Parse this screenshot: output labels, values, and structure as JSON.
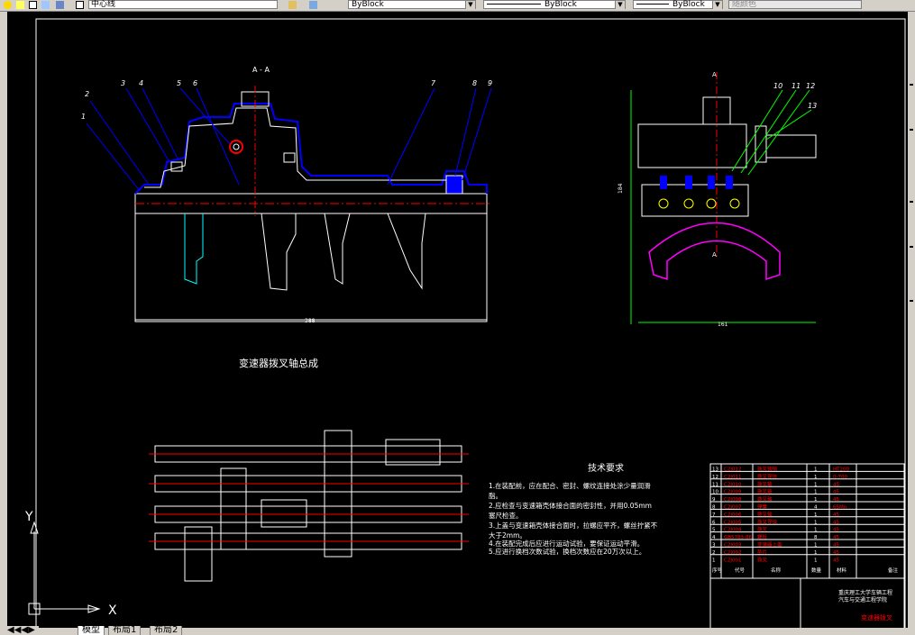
{
  "toolbar": {
    "layer_name": "中心线",
    "linetype_1": "ByBlock",
    "linetype_2": "ByBlock",
    "lineweight": "ByBlock",
    "plotstyle": "随颜色"
  },
  "drawing": {
    "section_label": "A - A",
    "main_title": "变速器拨叉轴总成",
    "dim_width": "388",
    "dim_side_width": "161",
    "dim_side_height": "184",
    "balloon_left": [
      "1",
      "2",
      "3",
      "4",
      "5",
      "6",
      "7",
      "8",
      "9"
    ],
    "balloon_right": [
      "10",
      "11",
      "12",
      "13"
    ],
    "section_mark": "A",
    "tech_title": "技术要求",
    "tech_lines": [
      "1.在装配前，应在配合、密封、螺纹连接处涂少量润滑",
      "脂。",
      "2.应检查与变速箱壳体接合面的密封性，并用0.05mm",
      "塞尺检查。",
      "3.上盖与变速箱壳体接合面时，拉螺应平齐，螺丝拧紧不",
      "大于2mm。",
      "4.在装配完成后应进行运动试验，要保证运动平滑。",
      "5.应进行换档次数试验，换档次数应在20万次以上。"
    ],
    "bom": [
      {
        "no": "13",
        "code": "C2J012",
        "name": "拨叉锁销",
        "qty": "1",
        "mat": "HT200"
      },
      {
        "no": "12",
        "code": "C2J011",
        "name": "拨叉导块",
        "qty": "1",
        "mat": "0-700"
      },
      {
        "no": "11",
        "code": "C2J010",
        "name": "拨叉轴",
        "qty": "1",
        "mat": "45"
      },
      {
        "no": "10",
        "code": "C2J009",
        "name": "拨叉轴",
        "qty": "1",
        "mat": "45"
      },
      {
        "no": "9",
        "code": "C2J008",
        "name": "拨叉轴",
        "qty": "1",
        "mat": "45"
      },
      {
        "no": "8",
        "code": "C2J007",
        "name": "弹簧",
        "qty": "4",
        "mat": "65Mn"
      },
      {
        "no": "7",
        "code": "C2J006",
        "name": "拨叉轴",
        "qty": "1",
        "mat": "45"
      },
      {
        "no": "6",
        "code": "C2J005",
        "name": "拨叉导块",
        "qty": "1",
        "mat": "45"
      },
      {
        "no": "5",
        "code": "C2J004",
        "name": "拨叉",
        "qty": "1",
        "mat": "45"
      },
      {
        "no": "4",
        "code": "GB5783-86",
        "name": "螺栓",
        "qty": "8",
        "mat": "45"
      },
      {
        "no": "3",
        "code": "C2J003",
        "name": "变速器上盖",
        "qty": "1",
        "mat": "45"
      },
      {
        "no": "2",
        "code": "C2J002",
        "name": "垫片",
        "qty": "1",
        "mat": "45"
      },
      {
        "no": "1",
        "code": "C2J001",
        "name": "拨叉",
        "qty": "1",
        "mat": "45"
      }
    ],
    "bom_header": [
      "序号",
      "代号",
      "名称",
      "数量",
      "材料",
      "备注"
    ],
    "title_block_1": "重庆理工大学车辆工程",
    "title_block_2": "汽车与交通工程学院",
    "drawing_name": "变速器拨叉",
    "ucs_x": "X",
    "ucs_y": "Y"
  },
  "tabs": [
    "模型",
    "布局1",
    "布局2"
  ],
  "colors": {
    "canvas": "#000000",
    "white": "#ffffff",
    "red": "#ff0000",
    "blue": "#0000ff",
    "cyan": "#00ffff",
    "green": "#00ff00",
    "magenta": "#ff00ff",
    "yellow": "#ffff00"
  }
}
